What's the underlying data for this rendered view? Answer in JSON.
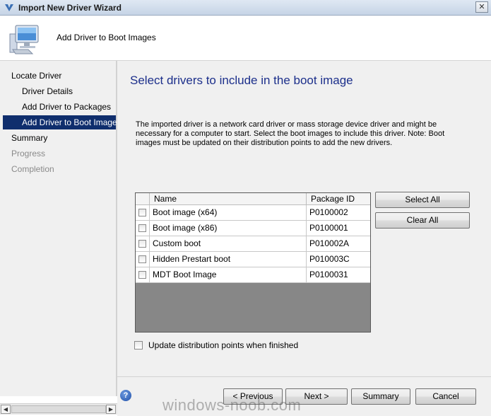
{
  "window": {
    "title": "Import New Driver Wizard",
    "close_glyph": "✕",
    "header_title": "Add Driver to Boot Images",
    "icons": [
      "wizard-logo-icon",
      "computer-icon",
      "close-icon"
    ]
  },
  "sidebar": {
    "items": [
      {
        "label": "Locate Driver",
        "level": 0,
        "state": "normal"
      },
      {
        "label": "Driver Details",
        "level": 1,
        "state": "normal"
      },
      {
        "label": "Add Driver to Packages",
        "level": 1,
        "state": "normal"
      },
      {
        "label": "Add Driver to Boot Images",
        "level": 1,
        "state": "selected"
      },
      {
        "label": "Summary",
        "level": 0,
        "state": "normal"
      },
      {
        "label": "Progress",
        "level": 0,
        "state": "disabled"
      },
      {
        "label": "Completion",
        "level": 0,
        "state": "disabled"
      }
    ]
  },
  "main": {
    "title": "Select drivers to include in the boot image",
    "description": "The imported driver is a network card driver or mass storage device driver and might be necessary for a computer to start. Select the boot images to include this driver.  Note: Boot images must be updated on their distribution points to add the new drivers.",
    "table": {
      "columns": [
        "Name",
        "Package ID"
      ],
      "rows": [
        {
          "name": "Boot image (x64)",
          "package_id": "P0100002",
          "checked": false
        },
        {
          "name": "Boot image (x86)",
          "package_id": "P0100001",
          "checked": false
        },
        {
          "name": "Custom boot",
          "package_id": "P010002A",
          "checked": false
        },
        {
          "name": "Hidden Prestart boot",
          "package_id": "P010003C",
          "checked": false
        },
        {
          "name": "MDT Boot Image",
          "package_id": "P0100031",
          "checked": false
        }
      ]
    },
    "select_all_label": "Select All",
    "clear_all_label": "Clear All",
    "update_dp_label": "Update distribution points when finished",
    "update_dp_checked": false
  },
  "footer": {
    "help_glyph": "?",
    "previous_label": "< Previous",
    "next_label": "Next >",
    "summary_label": "Summary",
    "cancel_label": "Cancel"
  },
  "scrollbar": {
    "left_glyph": "◀",
    "right_glyph": "▶"
  },
  "watermark": "windows-noob.com",
  "colors": {
    "selected_bg": "#0f2e6d",
    "title_color": "#1c2f8b",
    "panel_bg": "#f0f0f0"
  }
}
